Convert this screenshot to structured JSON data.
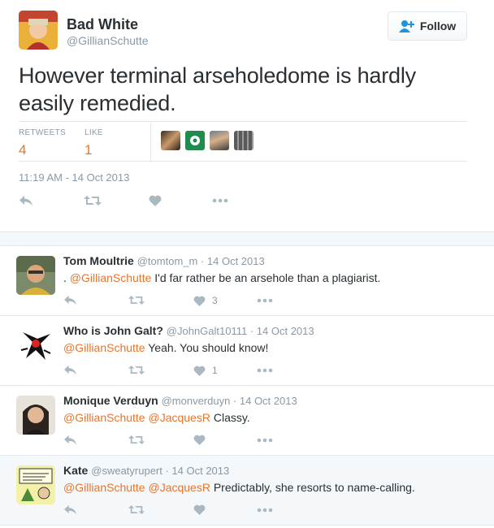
{
  "main_tweet": {
    "display_name": "Bad White",
    "handle": "@GillianSchutte",
    "follow_label": "Follow",
    "text": "However terminal arseholedome is hardly easily remedied.",
    "retweets_label": "RETWEETS",
    "retweets_count": "4",
    "likes_label": "LIKE",
    "likes_count": "1",
    "timestamp": "11:19 AM - 14 Oct 2013"
  },
  "replies": [
    {
      "name": "Tom Moultrie",
      "meta": "@tomtom_m · 14 Oct 2013",
      "prefix": ". ",
      "mentions": "@GillianSchutte",
      "body": " I'd far rather be an arsehole than a plagiarist.",
      "like_count": "3"
    },
    {
      "name": "Who is John Galt?",
      "meta": "@JohnGalt10111 · 14 Oct 2013",
      "prefix": "",
      "mentions": "@GillianSchutte",
      "body": " Yeah. You should know!",
      "like_count": "1"
    },
    {
      "name": "Monique Verduyn",
      "meta": "@monverduyn · 14 Oct 2013",
      "prefix": "",
      "mentions": "@GillianSchutte @JacquesR",
      "body": " Classy.",
      "like_count": ""
    },
    {
      "name": "Kate",
      "meta": "@sweatyrupert · 14 Oct 2013",
      "prefix": "",
      "mentions": "@GillianSchutte @JacquesR",
      "body": " Predictably, she resorts to name-calling.",
      "like_count": ""
    }
  ],
  "colors": {
    "accent": "#e6752c",
    "muted": "#8899a6",
    "follow_blue": "#1b95e0"
  }
}
